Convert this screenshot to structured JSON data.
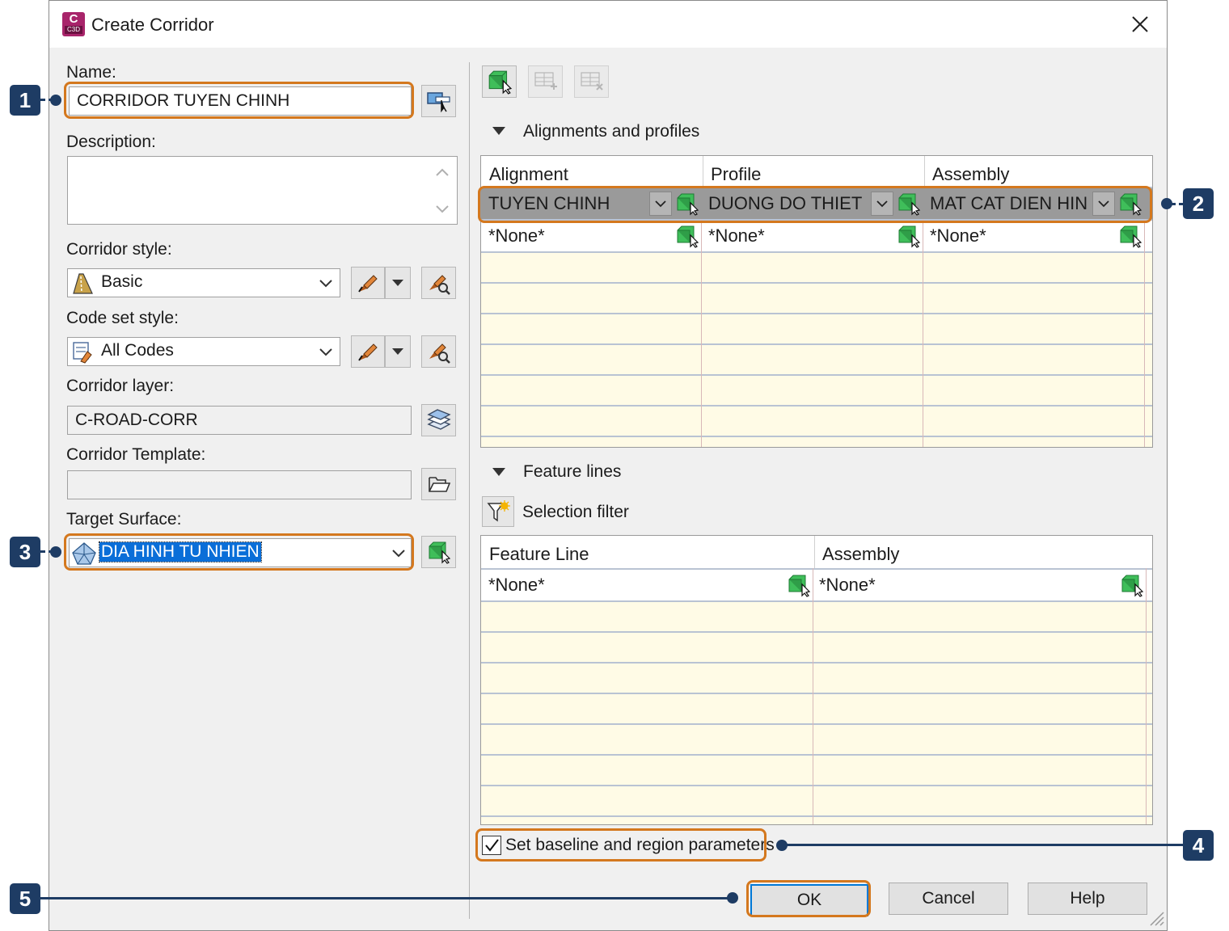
{
  "window": {
    "title": "Create Corridor",
    "app_icon_letter": "C",
    "app_icon_sub": "C3D"
  },
  "left": {
    "name_label": "Name:",
    "name_value": "CORRIDOR TUYEN CHINH",
    "description_label": "Description:",
    "description_value": "",
    "corridor_style_label": "Corridor style:",
    "corridor_style_value": "Basic",
    "code_set_style_label": "Code set style:",
    "code_set_style_value": "All Codes",
    "corridor_layer_label": "Corridor layer:",
    "corridor_layer_value": "C-ROAD-CORR",
    "corridor_template_label": "Corridor Template:",
    "corridor_template_value": "",
    "target_surface_label": "Target Surface:",
    "target_surface_value": "DIA HINH TU NHIEN"
  },
  "alignments": {
    "section_title": "Alignments and profiles",
    "columns": [
      "Alignment",
      "Profile",
      "Assembly"
    ],
    "rows": [
      [
        "TUYEN CHINH",
        "DUONG DO THIET",
        "MAT CAT DIEN HIN"
      ],
      [
        "*None*",
        "*None*",
        "*None*"
      ]
    ]
  },
  "features": {
    "section_title": "Feature lines",
    "filter_label": "Selection filter",
    "columns": [
      "Feature Line",
      "Assembly"
    ],
    "rows": [
      [
        "*None*",
        "*None*"
      ]
    ]
  },
  "options": {
    "baseline_label": "Set baseline and region parameters",
    "baseline_checked": true
  },
  "buttons": {
    "ok": "OK",
    "cancel": "Cancel",
    "help": "Help"
  },
  "callouts": [
    "1",
    "2",
    "3",
    "4",
    "5"
  ],
  "colors": {
    "accent_orange": "#d4781e",
    "callout_navy": "#1e3c64",
    "grid_empty_row": "#fffbe6",
    "selected_row": "#9a9a9a",
    "selection_blue": "#0a6ed8"
  }
}
